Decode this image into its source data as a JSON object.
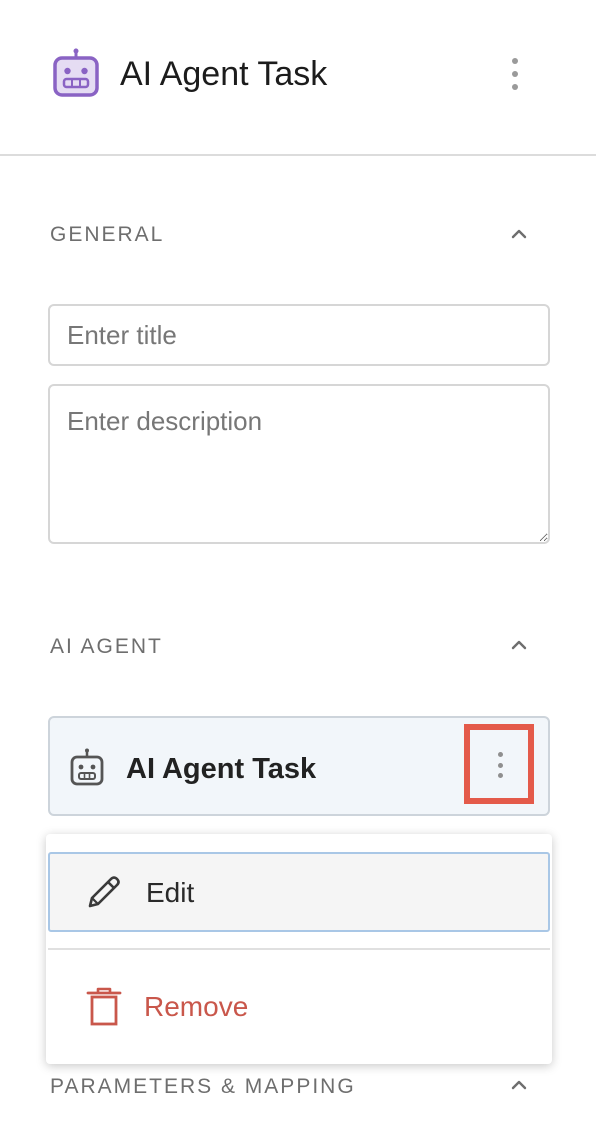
{
  "header": {
    "title": "AI Agent Task",
    "icon": "robot-icon",
    "icon_color": "#8a63c4",
    "icon_fill": "#e5dcf3",
    "menu_icon": "more-vertical-icon"
  },
  "general": {
    "label": "GENERAL",
    "collapse_icon": "chevron-up-icon",
    "title_placeholder": "Enter title",
    "title_value": "",
    "description_placeholder": "Enter description",
    "description_value": ""
  },
  "ai_agent": {
    "label": "AI AGENT",
    "collapse_icon": "chevron-up-icon",
    "card": {
      "title": "AI Agent Task",
      "icon": "robot-icon",
      "menu_icon": "more-vertical-icon",
      "highlight_color": "#e45a4a"
    },
    "menu": {
      "items": [
        {
          "label": "Edit",
          "icon": "pencil-icon"
        },
        {
          "label": "Remove",
          "icon": "trash-icon",
          "color": "#c9574b"
        }
      ]
    }
  },
  "parameters": {
    "label": "PARAMETERS & MAPPING",
    "collapse_icon": "chevron-up-icon"
  }
}
